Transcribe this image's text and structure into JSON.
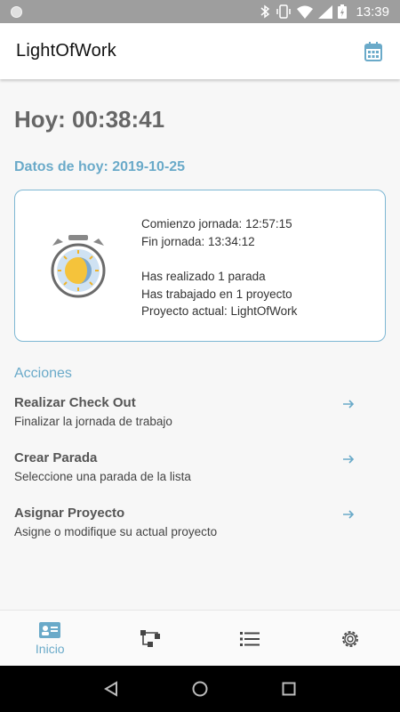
{
  "status_bar": {
    "time": "13:39"
  },
  "app_bar": {
    "title": "LightOfWork",
    "calendar_icon": "calendar-icon"
  },
  "main": {
    "today_counter": "Hoy: 00:38:41",
    "today_data_heading": "Datos de hoy: 2019-10-25",
    "summary_card": {
      "clock_icon": "stopwatch-sun-icon",
      "lines_top": [
        "Comienzo jornada: 12:57:15",
        "Fin jornada: 13:34:12"
      ],
      "lines_bottom": [
        "Has realizado 1 parada",
        "Has trabajado en 1 proyecto",
        "Proyecto actual: LightOfWork"
      ]
    },
    "actions_heading": "Acciones",
    "actions": [
      {
        "title": "Realizar Check Out",
        "subtitle": "Finalizar la jornada de trabajo"
      },
      {
        "title": "Crear Parada",
        "subtitle": "Seleccione una parada de la lista"
      },
      {
        "title": "Asignar Proyecto",
        "subtitle": "Asigne o modifique su actual proyecto"
      }
    ]
  },
  "bottom_nav": {
    "items": [
      {
        "icon": "id-card-icon",
        "label": "Inicio",
        "active": true
      },
      {
        "icon": "hierarchy-icon"
      },
      {
        "icon": "list-icon"
      },
      {
        "icon": "gear-icon"
      }
    ]
  },
  "colors": {
    "accent": "#6aaac9",
    "card_border": "#7db7d3",
    "title_gray": "#666666"
  }
}
